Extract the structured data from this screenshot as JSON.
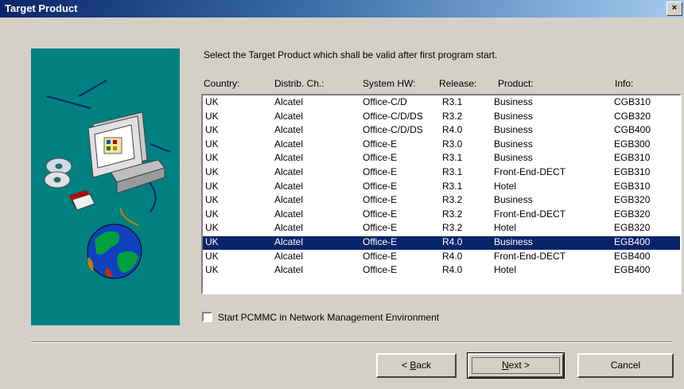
{
  "window": {
    "title": "Target Product",
    "close_glyph": "×"
  },
  "instruction": "Select the Target Product which shall be valid after first program start.",
  "table": {
    "headers": [
      "Country:",
      "Distrib. Ch.:",
      "System HW:",
      "Release:",
      "Product:",
      "Info:"
    ],
    "rows": [
      [
        "UK",
        "Alcatel",
        "Office-C/D",
        "R3.1",
        "Business",
        "CGB310"
      ],
      [
        "UK",
        "Alcatel",
        "Office-C/D/DS",
        "R3.2",
        "Business",
        "CGB320"
      ],
      [
        "UK",
        "Alcatel",
        "Office-C/D/DS",
        "R4.0",
        "Business",
        "CGB400"
      ],
      [
        "UK",
        "Alcatel",
        "Office-E",
        "R3.0",
        "Business",
        "EGB300"
      ],
      [
        "UK",
        "Alcatel",
        "Office-E",
        "R3.1",
        "Business",
        "EGB310"
      ],
      [
        "UK",
        "Alcatel",
        "Office-E",
        "R3.1",
        "Front-End-DECT",
        "EGB310"
      ],
      [
        "UK",
        "Alcatel",
        "Office-E",
        "R3.1",
        "Hotel",
        "EGB310"
      ],
      [
        "UK",
        "Alcatel",
        "Office-E",
        "R3.2",
        "Business",
        "EGB320"
      ],
      [
        "UK",
        "Alcatel",
        "Office-E",
        "R3.2",
        "Front-End-DECT",
        "EGB320"
      ],
      [
        "UK",
        "Alcatel",
        "Office-E",
        "R3.2",
        "Hotel",
        "EGB320"
      ],
      [
        "UK",
        "Alcatel",
        "Office-E",
        "R4.0",
        "Business",
        "EGB400"
      ],
      [
        "UK",
        "Alcatel",
        "Office-E",
        "R4.0",
        "Front-End-DECT",
        "EGB400"
      ],
      [
        "UK",
        "Alcatel",
        "Office-E",
        "R4.0",
        "Hotel",
        "EGB400"
      ]
    ],
    "selected_index": 10
  },
  "checkbox": {
    "label": "Start PCMMC in Network Management Environment",
    "checked": false
  },
  "buttons": {
    "back": {
      "prefix": "< ",
      "accel": "B",
      "rest": "ack"
    },
    "next": {
      "accel": "N",
      "rest": "ext >"
    },
    "cancel": "Cancel"
  },
  "colors": {
    "selection": "#0a246a",
    "art_background": "#008080",
    "face": "#d4d0c8"
  },
  "icons": [
    "computer-icon",
    "cd-icon",
    "floppy-icon",
    "globe-icon"
  ]
}
